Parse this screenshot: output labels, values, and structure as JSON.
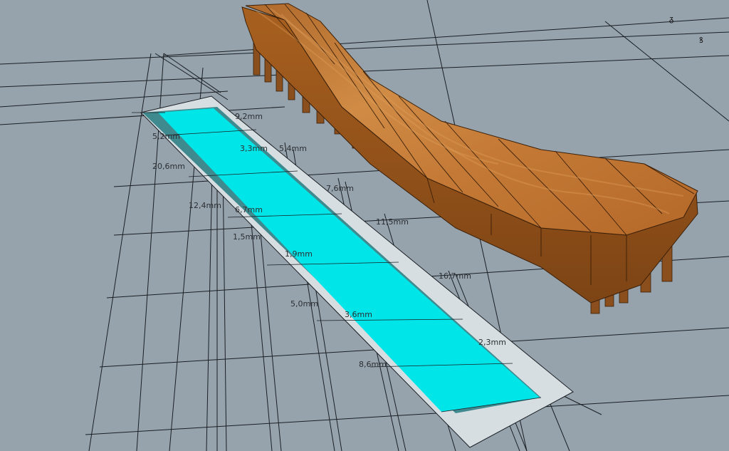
{
  "viewport": {
    "background": "#96a3ad",
    "colors": {
      "panel_cyan": "#00e5e8",
      "panel_shadow": "#3f8a8f",
      "panel_pale": "#d6dee2",
      "wood_light": "#c9853f",
      "wood_dark": "#8a4f1c",
      "grid_line": "#1a1f24"
    }
  },
  "objects": [
    {
      "name": "wooden-rib-model",
      "label": ""
    },
    {
      "name": "flattened-panel-template",
      "label": ""
    }
  ],
  "dimensions": [
    "9,2mm",
    "3,3mm",
    "5,4mm",
    "5,2mm",
    "20,6mm",
    "7,6mm",
    "12,4mm",
    "6,7mm",
    "11,5mm",
    "1,5mm",
    "1,9mm",
    "16,7mm",
    "5,0mm",
    "3,6mm",
    "2,3mm",
    "8,6mm"
  ]
}
